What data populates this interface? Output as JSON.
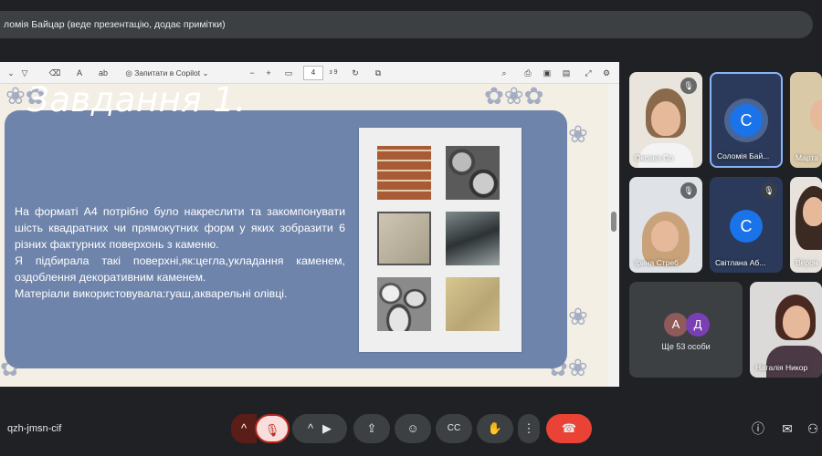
{
  "header": {
    "presenter_text": "ломія Байцар (веде презентацію, додає примітки)"
  },
  "pdf_toolbar": {
    "ask_copilot": "Запитати в Copilot",
    "page_current": "4",
    "page_total": "з 9",
    "zoom_out": "−",
    "zoom_in": "+"
  },
  "slide": {
    "title": "Завдання 1.",
    "body_lines": [
      "На форматі А4 потрібно було накреслити та закомпонувати шість квадратних чи прямокутних форм у яких зобразити 6 різних фактурних поверхонь з каменю.",
      "Я підбирала такі поверхні,як:цегла,укладання каменем, оздоблення декоративним каменем.",
      "Матеріали використовувала:гуаш,акварельні олівці."
    ]
  },
  "participants": [
    {
      "name": "Оксана Со",
      "type": "video",
      "muted": true
    },
    {
      "name": "Соломія Бай...",
      "type": "avatar",
      "initial": "С",
      "active": true
    },
    {
      "name": "Марта",
      "type": "video",
      "muted": false
    },
    {
      "name": "Ірина Стреб",
      "type": "video",
      "muted": true
    },
    {
      "name": "Світлана Аб...",
      "type": "avatar",
      "initial": "С",
      "muted": true
    },
    {
      "name": "Верон",
      "type": "video",
      "muted": false
    },
    {
      "name": "Ще 53 особи",
      "type": "more",
      "initials": [
        "А",
        "Д"
      ]
    },
    {
      "name": "Наталія Никор",
      "type": "video",
      "muted": false
    }
  ],
  "controls": {
    "meeting_code": "qzh-jmsn-cif"
  },
  "colors": {
    "slide_panel": "#6e84ab",
    "active_border": "#8ab4f8",
    "end_call": "#ea4335",
    "avatar_blue": "#1a73e8",
    "avatar_a": "#8e5a5a",
    "avatar_d": "#7b3fb5"
  }
}
